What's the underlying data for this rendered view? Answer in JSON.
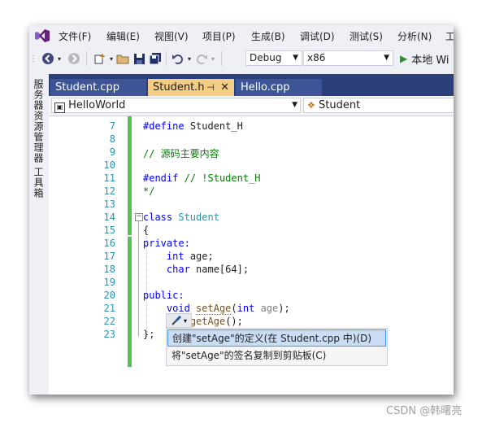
{
  "menu": [
    "文件(F)",
    "编辑(E)",
    "视图(V)",
    "项目(P)",
    "生成(B)",
    "调试(D)",
    "测试(S)",
    "分析(N)",
    "工"
  ],
  "toolbar": {
    "config": "Debug",
    "platform": "x86",
    "run_label": "本地 Wi"
  },
  "side_tools": [
    "服务器资源管理器",
    "工具箱"
  ],
  "tabs": [
    {
      "label": "Student.cpp",
      "active": false
    },
    {
      "label": "Student.h",
      "active": true
    },
    {
      "label": "Hello.cpp",
      "active": false
    }
  ],
  "nav": {
    "project": "HelloWorld",
    "scope": "Student"
  },
  "code_lines": [
    {
      "num": "7",
      "text": "#define Student_H"
    },
    {
      "num": "8",
      "text": ""
    },
    {
      "num": "9",
      "text": "// 源码主要内容"
    },
    {
      "num": "10",
      "text": ""
    },
    {
      "num": "11",
      "text": "#endif // !Student_H"
    },
    {
      "num": "12",
      "text": "*/"
    },
    {
      "num": "13",
      "text": ""
    },
    {
      "num": "14",
      "text": "class Student"
    },
    {
      "num": "15",
      "text": "{"
    },
    {
      "num": "16",
      "text": "private:"
    },
    {
      "num": "17",
      "text": "    int age;"
    },
    {
      "num": "18",
      "text": "    char name[64];"
    },
    {
      "num": "19",
      "text": ""
    },
    {
      "num": "20",
      "text": "public:"
    },
    {
      "num": "21",
      "text": "    void setAge(int age);"
    },
    {
      "num": "22",
      "text": "    int getAge();"
    },
    {
      "num": "23",
      "text": "};"
    }
  ],
  "quick_actions": [
    "创建\"setAge\"的定义(在 Student.cpp 中)(D)",
    "将\"setAge\"的签名复制到剪贴板(C)"
  ],
  "colors": {
    "accent": "#68217a",
    "tab_well": "#2b3f7a",
    "active_tab": "#f5cc84",
    "change_bar": "#57c357"
  },
  "watermark": "CSDN @韩曙亮"
}
